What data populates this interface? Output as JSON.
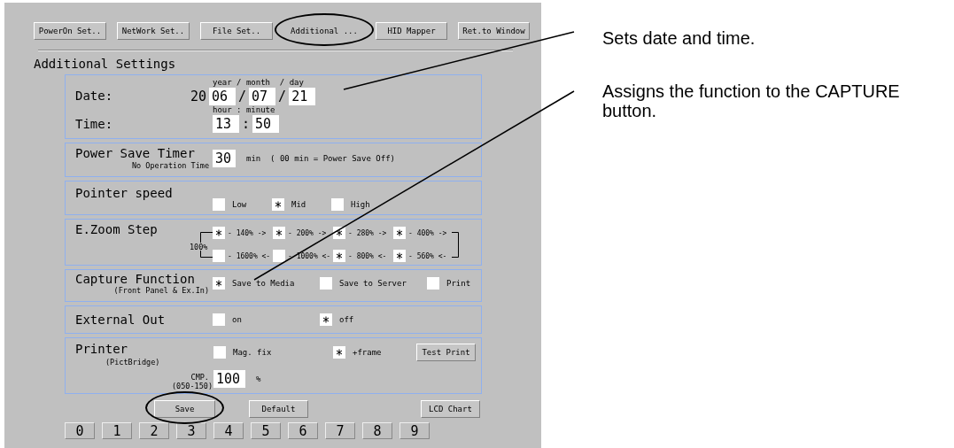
{
  "nav_buttons": [
    {
      "label": "PowerOn Set..",
      "selected": false,
      "highlighted": false
    },
    {
      "label": "NetWork Set..",
      "selected": false,
      "highlighted": false
    },
    {
      "label": "File Set..",
      "selected": false,
      "highlighted": false
    },
    {
      "label": "Additional ...",
      "selected": true,
      "highlighted": true
    },
    {
      "label": "HID Mapper",
      "selected": false,
      "highlighted": false
    },
    {
      "label": "Ret.to Window",
      "selected": false,
      "highlighted": false
    }
  ],
  "title": "Additional Settings",
  "date": {
    "label": "Date:",
    "caption": "year / month  / day",
    "prefix": "20",
    "fields": [
      "06",
      "07",
      "21"
    ],
    "separators": [
      "/",
      "/"
    ]
  },
  "time": {
    "label": "Time:",
    "caption": "hour : minute",
    "fields": [
      "13",
      "50"
    ],
    "separators": [
      ":"
    ]
  },
  "power_save": {
    "label": "Power Save Timer",
    "sublabel": "No Operation Time",
    "value": "30",
    "note": "min  ( 00 min = Power Save Off)"
  },
  "pointer_speed": {
    "label": "Pointer speed",
    "options": [
      {
        "label": "Low",
        "checked": false
      },
      {
        "label": "Mid",
        "checked": true
      },
      {
        "label": "High",
        "checked": false
      }
    ]
  },
  "zoom": {
    "label": "E.Zoom Step",
    "start": "100%",
    "top_row": [
      {
        "label": "- 140% ->",
        "checked": true
      },
      {
        "label": "- 200% ->",
        "checked": true
      },
      {
        "label": "- 280% ->",
        "checked": true
      },
      {
        "label": "- 400% ->",
        "checked": true
      }
    ],
    "bottom_row": [
      {
        "label": "- 1600% <-",
        "checked": false
      },
      {
        "label": "- 1000% <-",
        "checked": false
      },
      {
        "label": "- 800% <-",
        "checked": true
      },
      {
        "label": "- 560% <-",
        "checked": true
      }
    ]
  },
  "capture": {
    "label": "Capture Function",
    "sublabel": "(Front Panel & Ex.In)",
    "options": [
      {
        "label": "Save to Media",
        "checked": true
      },
      {
        "label": "Save to Server",
        "checked": false
      },
      {
        "label": "Print",
        "checked": false
      }
    ]
  },
  "external_out": {
    "label": "External Out",
    "options": [
      {
        "label": "on",
        "checked": false
      },
      {
        "label": "off",
        "checked": true
      }
    ]
  },
  "printer": {
    "label": "Printer",
    "sublabel": "(PictBridge)",
    "options": [
      {
        "label": "Mag. fix",
        "checked": false
      },
      {
        "label": "+frame",
        "checked": true
      }
    ],
    "test_button": "Test Print",
    "cmp_label": "CMP.",
    "cmp_range": "(050-150)",
    "cmp_value": "100",
    "cmp_unit": "%"
  },
  "bottom_buttons": [
    {
      "label": "Save",
      "highlighted": true
    },
    {
      "label": "Default",
      "highlighted": false
    },
    {
      "label": "LCD Chart",
      "highlighted": false
    }
  ],
  "keys": [
    "0",
    "1",
    "2",
    "3",
    "4",
    "5",
    "6",
    "7",
    "8",
    "9"
  ],
  "callouts": [
    {
      "text": "Sets date and time."
    },
    {
      "text": "Assigns the function to the CAPTURE button."
    }
  ]
}
